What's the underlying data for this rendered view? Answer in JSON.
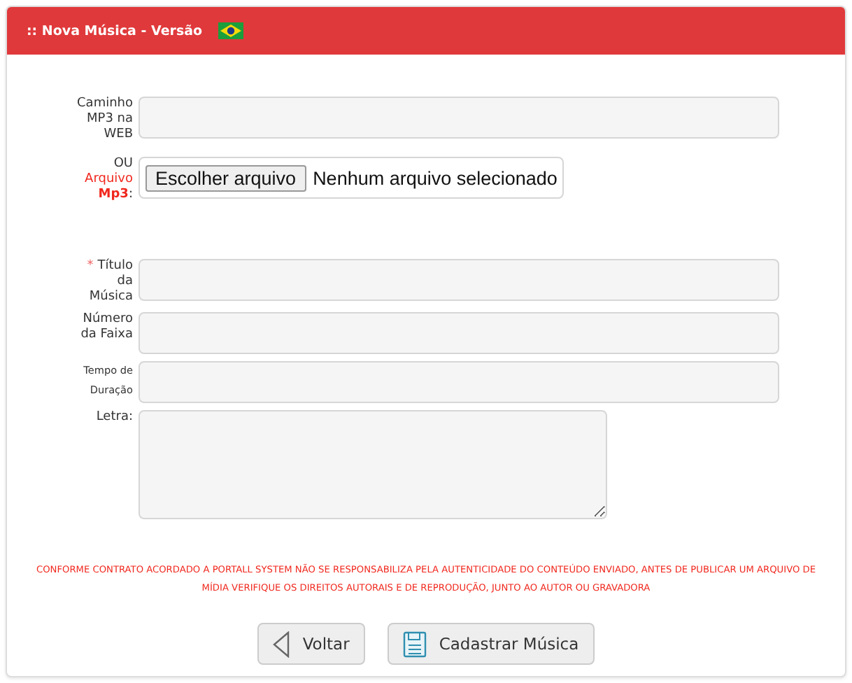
{
  "header": {
    "title": ":: Nova Música - Versão"
  },
  "source_fields": [
    {
      "kind": "text",
      "label": [
        {
          "text": "Caminho MP3 na WEB"
        }
      ]
    },
    {
      "kind": "file",
      "label": [
        {
          "text": "OU"
        },
        {
          "text": "Arquivo",
          "alert": true
        },
        {
          "text": "Mp3",
          "alert": true,
          "bold": true
        },
        {
          "text": ":"
        }
      ],
      "button": "Escolher arquivo",
      "status": "Nenhum arquivo selecionado"
    }
  ],
  "detail_fields": [
    {
      "kind": "text",
      "marker": "*",
      "label": [
        {
          "text": "Título da Música"
        }
      ]
    },
    {
      "kind": "text",
      "label": [
        {
          "text": "Número da Faixa"
        }
      ]
    },
    {
      "kind": "text",
      "small": true,
      "label": [
        {
          "text": "Tempo de Duração"
        }
      ]
    },
    {
      "kind": "textarea",
      "label": [
        {
          "text": "Letra:"
        }
      ]
    }
  ],
  "notice": "CONFORME CONTRATO ACORDADO A PORTALL SYSTEM NÃO SE RESPONSABILIZA PELA AUTENTICIDADE DO CONTEÚDO ENVIADO, ANTES DE PUBLICAR UM ARQUIVO DE MÍDIA VERIFIQUE OS DIREITOS AUTORAIS E DE REPRODUÇÃO, JUNTO AO AUTOR OU GRAVADORA",
  "buttons": [
    {
      "kind": "back",
      "label": "Voltar"
    },
    {
      "kind": "save",
      "label": "Cadastrar Música"
    }
  ]
}
